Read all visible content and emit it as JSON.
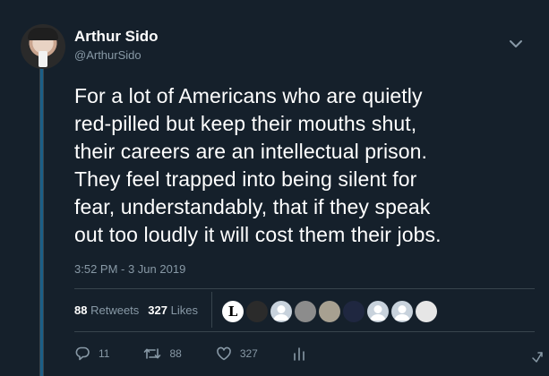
{
  "author": {
    "name": "Arthur Sido",
    "handle": "@ArthurSido"
  },
  "tweet": {
    "lines": [
      "For a lot of Americans who are quietly",
      "red-pilled but keep their mouths shut,",
      "their careers are an intellectual prison.",
      "They feel trapped into being silent for",
      "fear, understandably, that if they speak",
      "out too loudly it will cost them their jobs."
    ],
    "timestamp": "3:52 PM - 3 Jun 2019"
  },
  "stats": {
    "retweets_count": "88",
    "retweets_label": "Retweets",
    "likes_count": "327",
    "likes_label": "Likes"
  },
  "likers": [
    {
      "icon": "letter-l-logo",
      "text": "L",
      "bg": "#ffffff",
      "fg": "#000000"
    },
    {
      "icon": "dark-avatar",
      "text": "",
      "bg": "#2b2b2b",
      "fg": "#ffffff"
    },
    {
      "icon": "default-avatar-icon",
      "text": "",
      "bg": "#c8d2dc",
      "fg": "#ffffff"
    },
    {
      "icon": "photo-avatar",
      "text": "",
      "bg": "#8c8c8c",
      "fg": "#ffffff"
    },
    {
      "icon": "photo-avatar",
      "text": "",
      "bg": "#a7a091",
      "fg": "#ffffff"
    },
    {
      "icon": "photo-avatar",
      "text": "",
      "bg": "#1f2740",
      "fg": "#ffffff"
    },
    {
      "icon": "default-avatar-icon",
      "text": "",
      "bg": "#c8d2dc",
      "fg": "#ffffff"
    },
    {
      "icon": "default-avatar-icon",
      "text": "",
      "bg": "#c8d2dc",
      "fg": "#ffffff"
    },
    {
      "icon": "emblem-avatar",
      "text": "",
      "bg": "#e6e6e6",
      "fg": "#b02020"
    }
  ],
  "actions": {
    "reply_count": "11",
    "retweet_count": "88",
    "like_count": "327"
  },
  "colors": {
    "background": "#15202b",
    "text_primary": "#ffffff",
    "text_secondary": "#8899a6",
    "divider": "#38444d",
    "thread_line": "#1b5e86"
  }
}
